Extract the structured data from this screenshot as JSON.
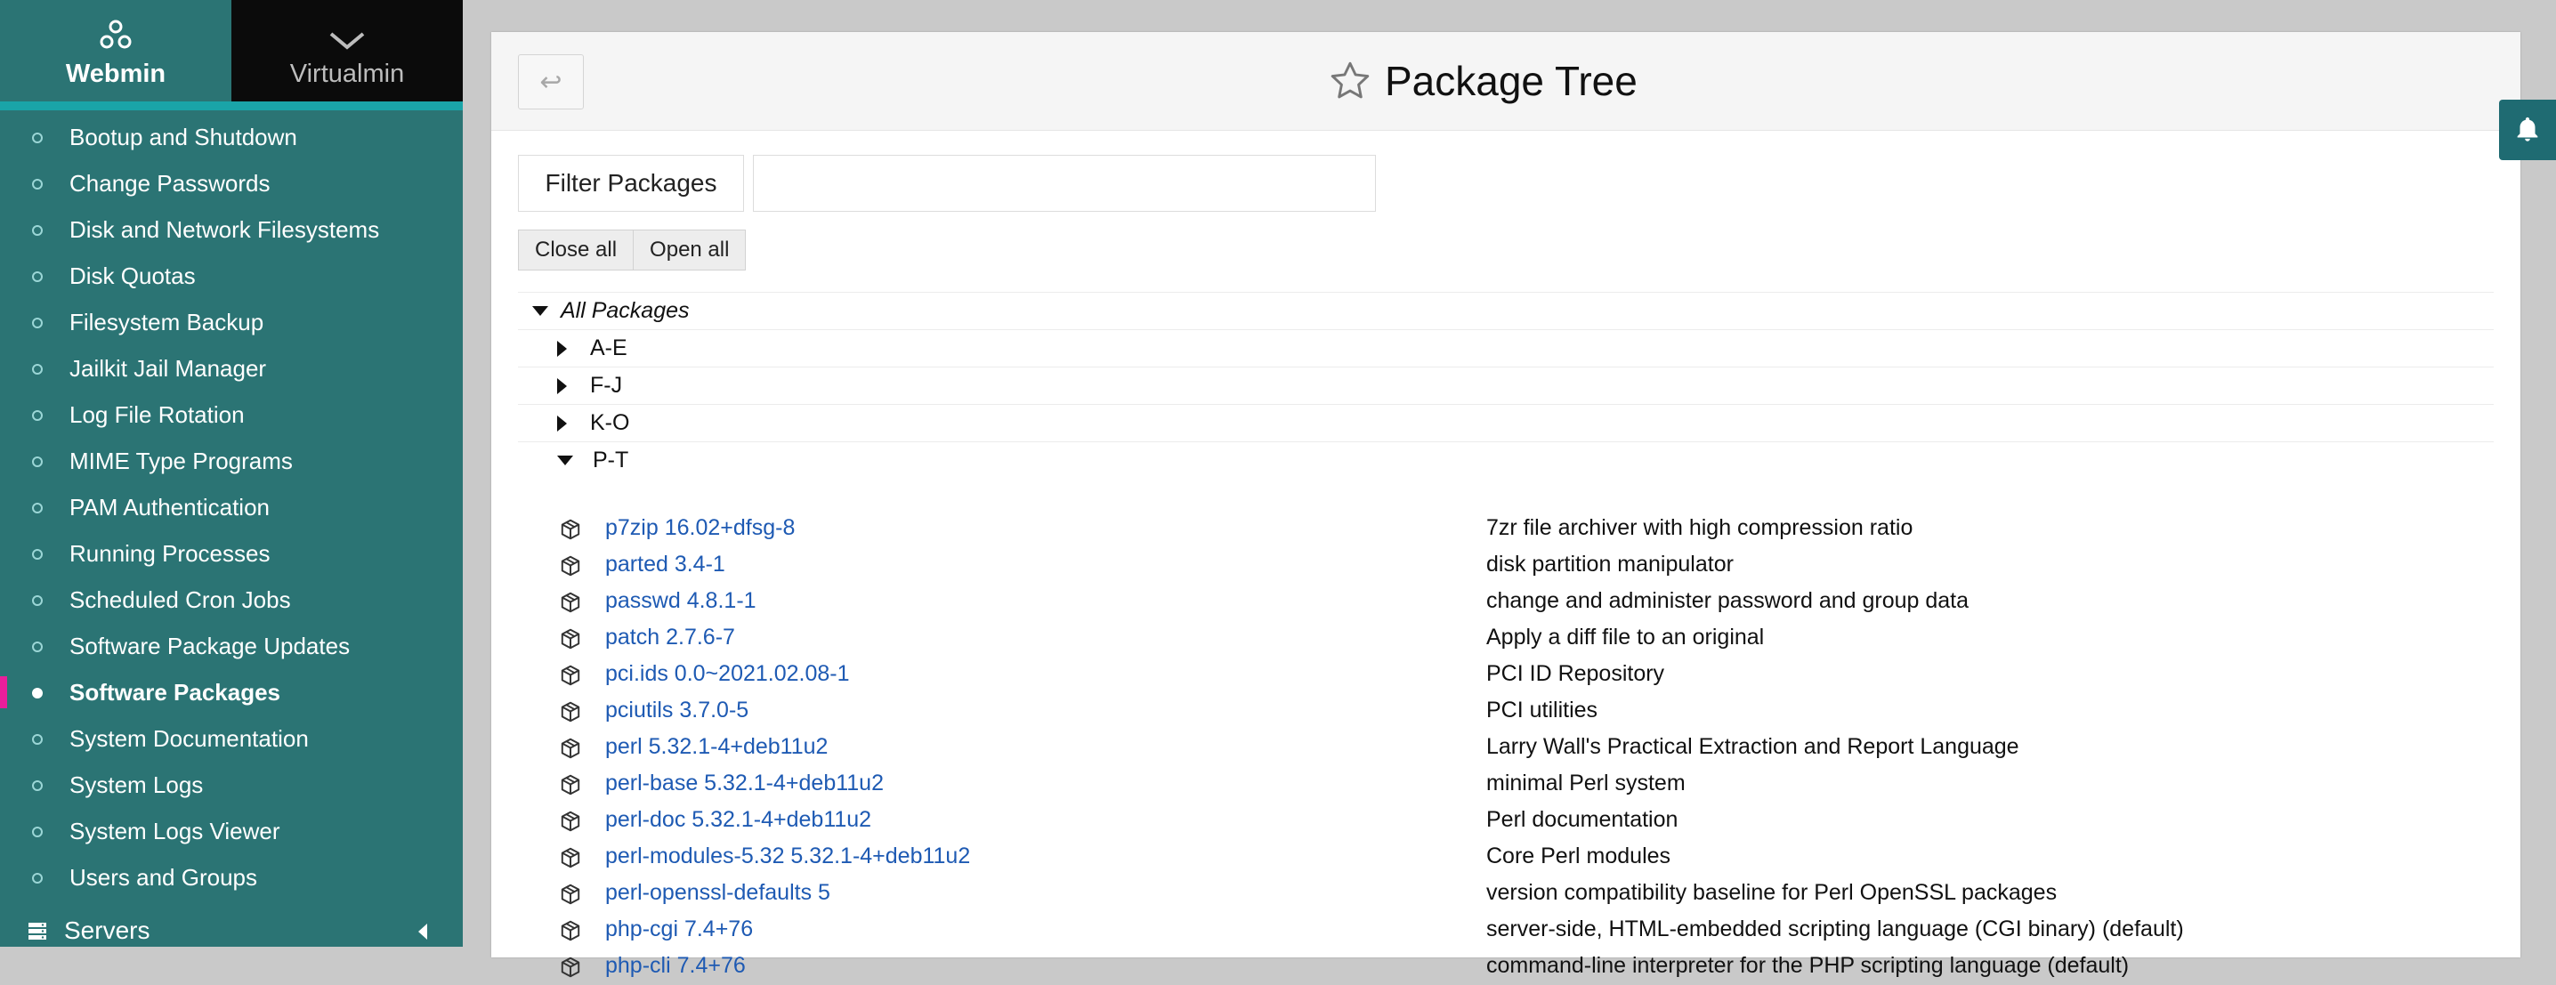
{
  "sidebar": {
    "tabs": {
      "webmin": "Webmin",
      "virtualmin": "Virtualmin"
    },
    "items": [
      {
        "label": "Bootup and Shutdown"
      },
      {
        "label": "Change Passwords"
      },
      {
        "label": "Disk and Network Filesystems"
      },
      {
        "label": "Disk Quotas"
      },
      {
        "label": "Filesystem Backup"
      },
      {
        "label": "Jailkit Jail Manager"
      },
      {
        "label": "Log File Rotation"
      },
      {
        "label": "MIME Type Programs"
      },
      {
        "label": "PAM Authentication"
      },
      {
        "label": "Running Processes"
      },
      {
        "label": "Scheduled Cron Jobs"
      },
      {
        "label": "Software Package Updates"
      },
      {
        "label": "Software Packages",
        "active": true
      },
      {
        "label": "System Documentation"
      },
      {
        "label": "System Logs"
      },
      {
        "label": "System Logs Viewer"
      },
      {
        "label": "Users and Groups"
      }
    ],
    "section": "Servers"
  },
  "header": {
    "title": "Package Tree",
    "back_icon": "return-arrow-icon",
    "favorite_icon": "star-outline-icon"
  },
  "filter": {
    "label": "Filter Packages",
    "value": "",
    "placeholder": ""
  },
  "buttons": {
    "close_all": "Close all",
    "open_all": "Open all"
  },
  "tree": {
    "root": "All Packages",
    "groups": [
      {
        "label": "A-E",
        "open": false
      },
      {
        "label": "F-J",
        "open": false
      },
      {
        "label": "K-O",
        "open": false
      },
      {
        "label": "P-T",
        "open": true
      }
    ]
  },
  "packages": [
    {
      "name": "p7zip 16.02+dfsg-8",
      "desc": "7zr file archiver with high compression ratio"
    },
    {
      "name": "parted 3.4-1",
      "desc": "disk partition manipulator"
    },
    {
      "name": "passwd 4.8.1-1",
      "desc": "change and administer password and group data"
    },
    {
      "name": "patch 2.7.6-7",
      "desc": "Apply a diff file to an original"
    },
    {
      "name": "pci.ids 0.0~2021.02.08-1",
      "desc": "PCI ID Repository"
    },
    {
      "name": "pciutils 3.7.0-5",
      "desc": "PCI utilities"
    },
    {
      "name": "perl 5.32.1-4+deb11u2",
      "desc": "Larry Wall's Practical Extraction and Report Language"
    },
    {
      "name": "perl-base 5.32.1-4+deb11u2",
      "desc": "minimal Perl system"
    },
    {
      "name": "perl-doc 5.32.1-4+deb11u2",
      "desc": "Perl documentation"
    },
    {
      "name": "perl-modules-5.32 5.32.1-4+deb11u2",
      "desc": "Core Perl modules"
    },
    {
      "name": "perl-openssl-defaults 5",
      "desc": "version compatibility baseline for Perl OpenSSL packages"
    },
    {
      "name": "php-cgi 7.4+76",
      "desc": "server-side, HTML-embedded scripting language (CGI binary) (default)"
    },
    {
      "name": "php-cli 7.4+76",
      "desc": "command-line interpreter for the PHP scripting language (default)"
    }
  ],
  "colors": {
    "sidebar": "#2b7474",
    "link": "#1e5ab3",
    "active_marker": "#e91e9b"
  },
  "notification_icon": "bell-icon"
}
